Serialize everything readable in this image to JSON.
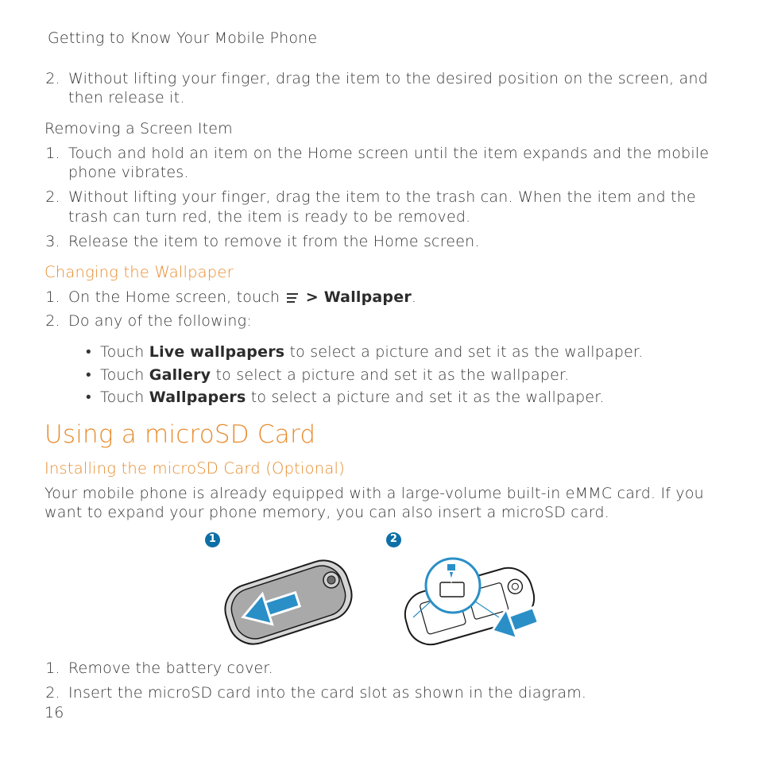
{
  "page_title": "Getting to Know Your Mobile Phone",
  "move_item_step2": "Without lifting your finger, drag the item to the desired position on the screen, and then release it.",
  "removing_head": "Removing a Screen Item",
  "removing_steps": [
    "Touch and hold an item on the Home screen until the item expands and the mobile phone vibrates.",
    "Without lifting your finger, drag the item to the trash can. When the item and the trash can turn red, the item is ready to be removed.",
    "Release the item to remove it from the Home screen."
  ],
  "wallpaper_head": "Changing the Wallpaper",
  "wallpaper_step1_pre": "On the Home screen, touch ",
  "wallpaper_step1_chevron": " > ",
  "wallpaper_step1_bold": "Wallpaper",
  "wallpaper_step1_post": ".",
  "wallpaper_step2": "Do any of the following:",
  "wallpaper_bullets": {
    "b1_pre": "Touch ",
    "b1_bold": "Live wallpapers",
    "b1_post": " to select a picture and set it as the wallpaper.",
    "b2_pre": "Touch ",
    "b2_bold": "Gallery",
    "b2_post": " to select a picture and set it as the wallpaper.",
    "b3_pre": "Touch ",
    "b3_bold": "Wallpapers",
    "b3_post": " to select a picture and set it as the wallpaper."
  },
  "microsd_h1": "Using a microSD Card",
  "installing_head": "Installing the microSD Card (Optional)",
  "installing_para": "Your mobile phone is already equipped with a large-volume built-in eMMC card. If you want to expand your phone memory, you can also insert a microSD card.",
  "badges": {
    "b1": "1",
    "b2": "2"
  },
  "installing_steps": [
    "Remove the battery cover.",
    "Insert the microSD card into the card slot as shown in the diagram."
  ],
  "page_number": "16"
}
